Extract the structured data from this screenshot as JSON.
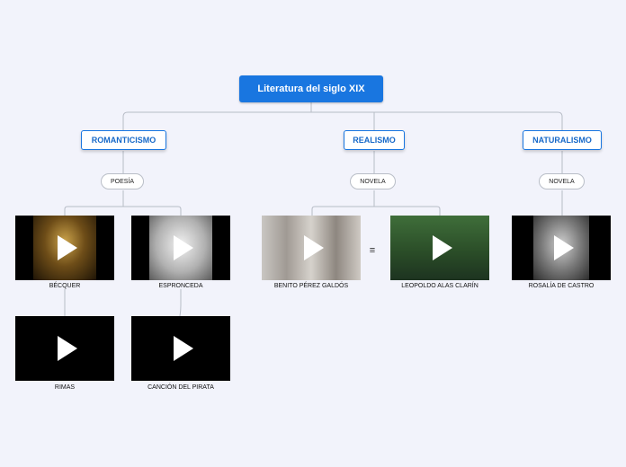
{
  "root": {
    "title": "Literatura del siglo XIX"
  },
  "branches": [
    {
      "label": "ROMANTICISMO",
      "subtopic": "POESÍA"
    },
    {
      "label": "REALISMO",
      "subtopic": "NOVELA"
    },
    {
      "label": "NATURALISMO",
      "subtopic": "NOVELA"
    }
  ],
  "videos": {
    "becquer": "BÉCQUER",
    "espronceda": "ESPRONCEDA",
    "galdos": "BENITO PÉREZ GALDÓS",
    "clarin": "LEOPOLDO ALAS CLARÍN",
    "rosalia": "ROSALÍA DE CASTRO",
    "rimas": "RIMAS",
    "pirata": "CANCIÓN DEL PIRATA"
  },
  "icons": {
    "play": "play-icon",
    "notes": "notes-icon"
  },
  "colors": {
    "accent": "#1976e0",
    "background": "#f2f3fb"
  }
}
